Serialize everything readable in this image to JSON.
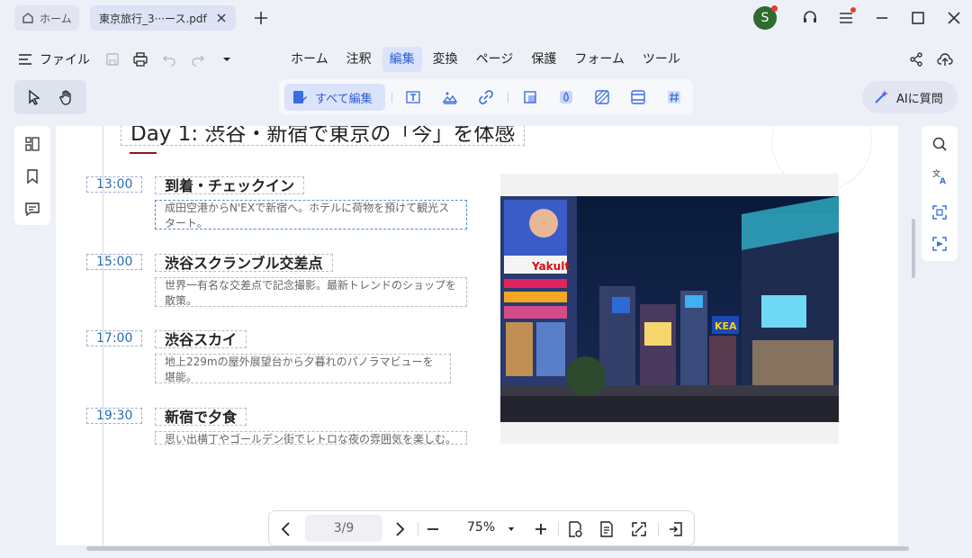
{
  "titlebar": {
    "home_tab": "ホーム",
    "doc_tab": "東京旅行_3···ース.pdf",
    "avatar_letter": "S"
  },
  "menu": {
    "file_label": "ファイル",
    "tabs": [
      "ホーム",
      "注釈",
      "編集",
      "変換",
      "ページ",
      "保護",
      "フォーム",
      "ツール"
    ],
    "active_tab": "編集"
  },
  "toolbar": {
    "edit_all_label": "すべて編集",
    "ai_label": "AIに質問"
  },
  "document": {
    "day_title": "Day 1: 渋谷・新宿で東京の「今」を体感",
    "events": [
      {
        "time": "13:00",
        "title": "到着・チェックイン",
        "desc": "成田空港からN'EXで新宿へ。ホテルに荷物を預けて観光スタート。"
      },
      {
        "time": "15:00",
        "title": "渋谷スクランブル交差点",
        "desc": "世界一有名な交差点で記念撮影。最新トレンドのショップを散策。"
      },
      {
        "time": "17:00",
        "title": "渋谷スカイ",
        "desc": "地上229mの屋外展望台から夕暮れのパノラマビューを堪能。"
      },
      {
        "time": "19:30",
        "title": "新宿で夕食",
        "desc": "思い出横丁やゴールデン街でレトロな夜の雰囲気を楽しむ。"
      }
    ],
    "photo_signs": [
      "Yakult",
      "KEA"
    ]
  },
  "bottom": {
    "page_indicator": "3/9",
    "zoom": "75%"
  },
  "colors": {
    "accent": "#2d5fd6",
    "time_text": "#2b6cb0",
    "title_underline": "#8b1a1a",
    "avatar_bg": "#2e6b2e",
    "notification": "#e53935"
  }
}
